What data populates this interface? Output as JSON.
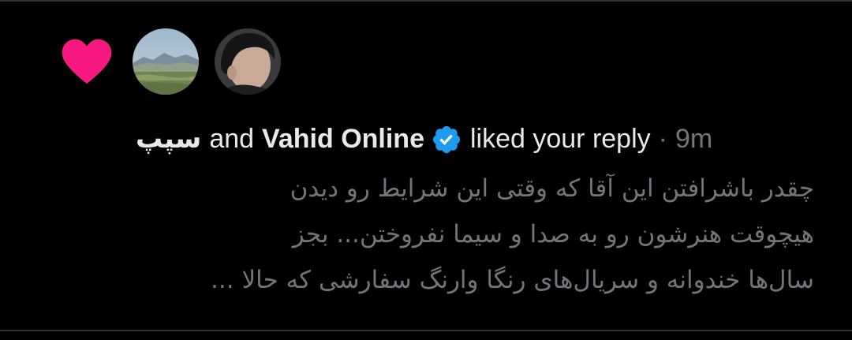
{
  "colors": {
    "background": "#000000",
    "heart": "#f91880",
    "verified": "#1d9bf0",
    "primary_text": "#e7e9ea",
    "secondary_text": "#71767b",
    "divider": "#2f3336"
  },
  "notification": {
    "type_icon": "heart-icon",
    "avatars": [
      {
        "icon": "landscape-avatar"
      },
      {
        "icon": "person-avatar"
      }
    ],
    "user1": "سپپ",
    "conjunction": "and",
    "user2": "Vahid Online",
    "user2_verified": true,
    "action": "liked your reply",
    "separator": "·",
    "time": "9m",
    "reply_lines": [
      "چقدر باشرافتن این آقا که وقتی این شرایط رو دیدن",
      "هیچوقت هنرشون رو به صدا و سیما نفروختن... بجز",
      "سال‌ها خندوانه و سریال‌های رنگا وارنگ سفارشی که حالا ..."
    ]
  }
}
